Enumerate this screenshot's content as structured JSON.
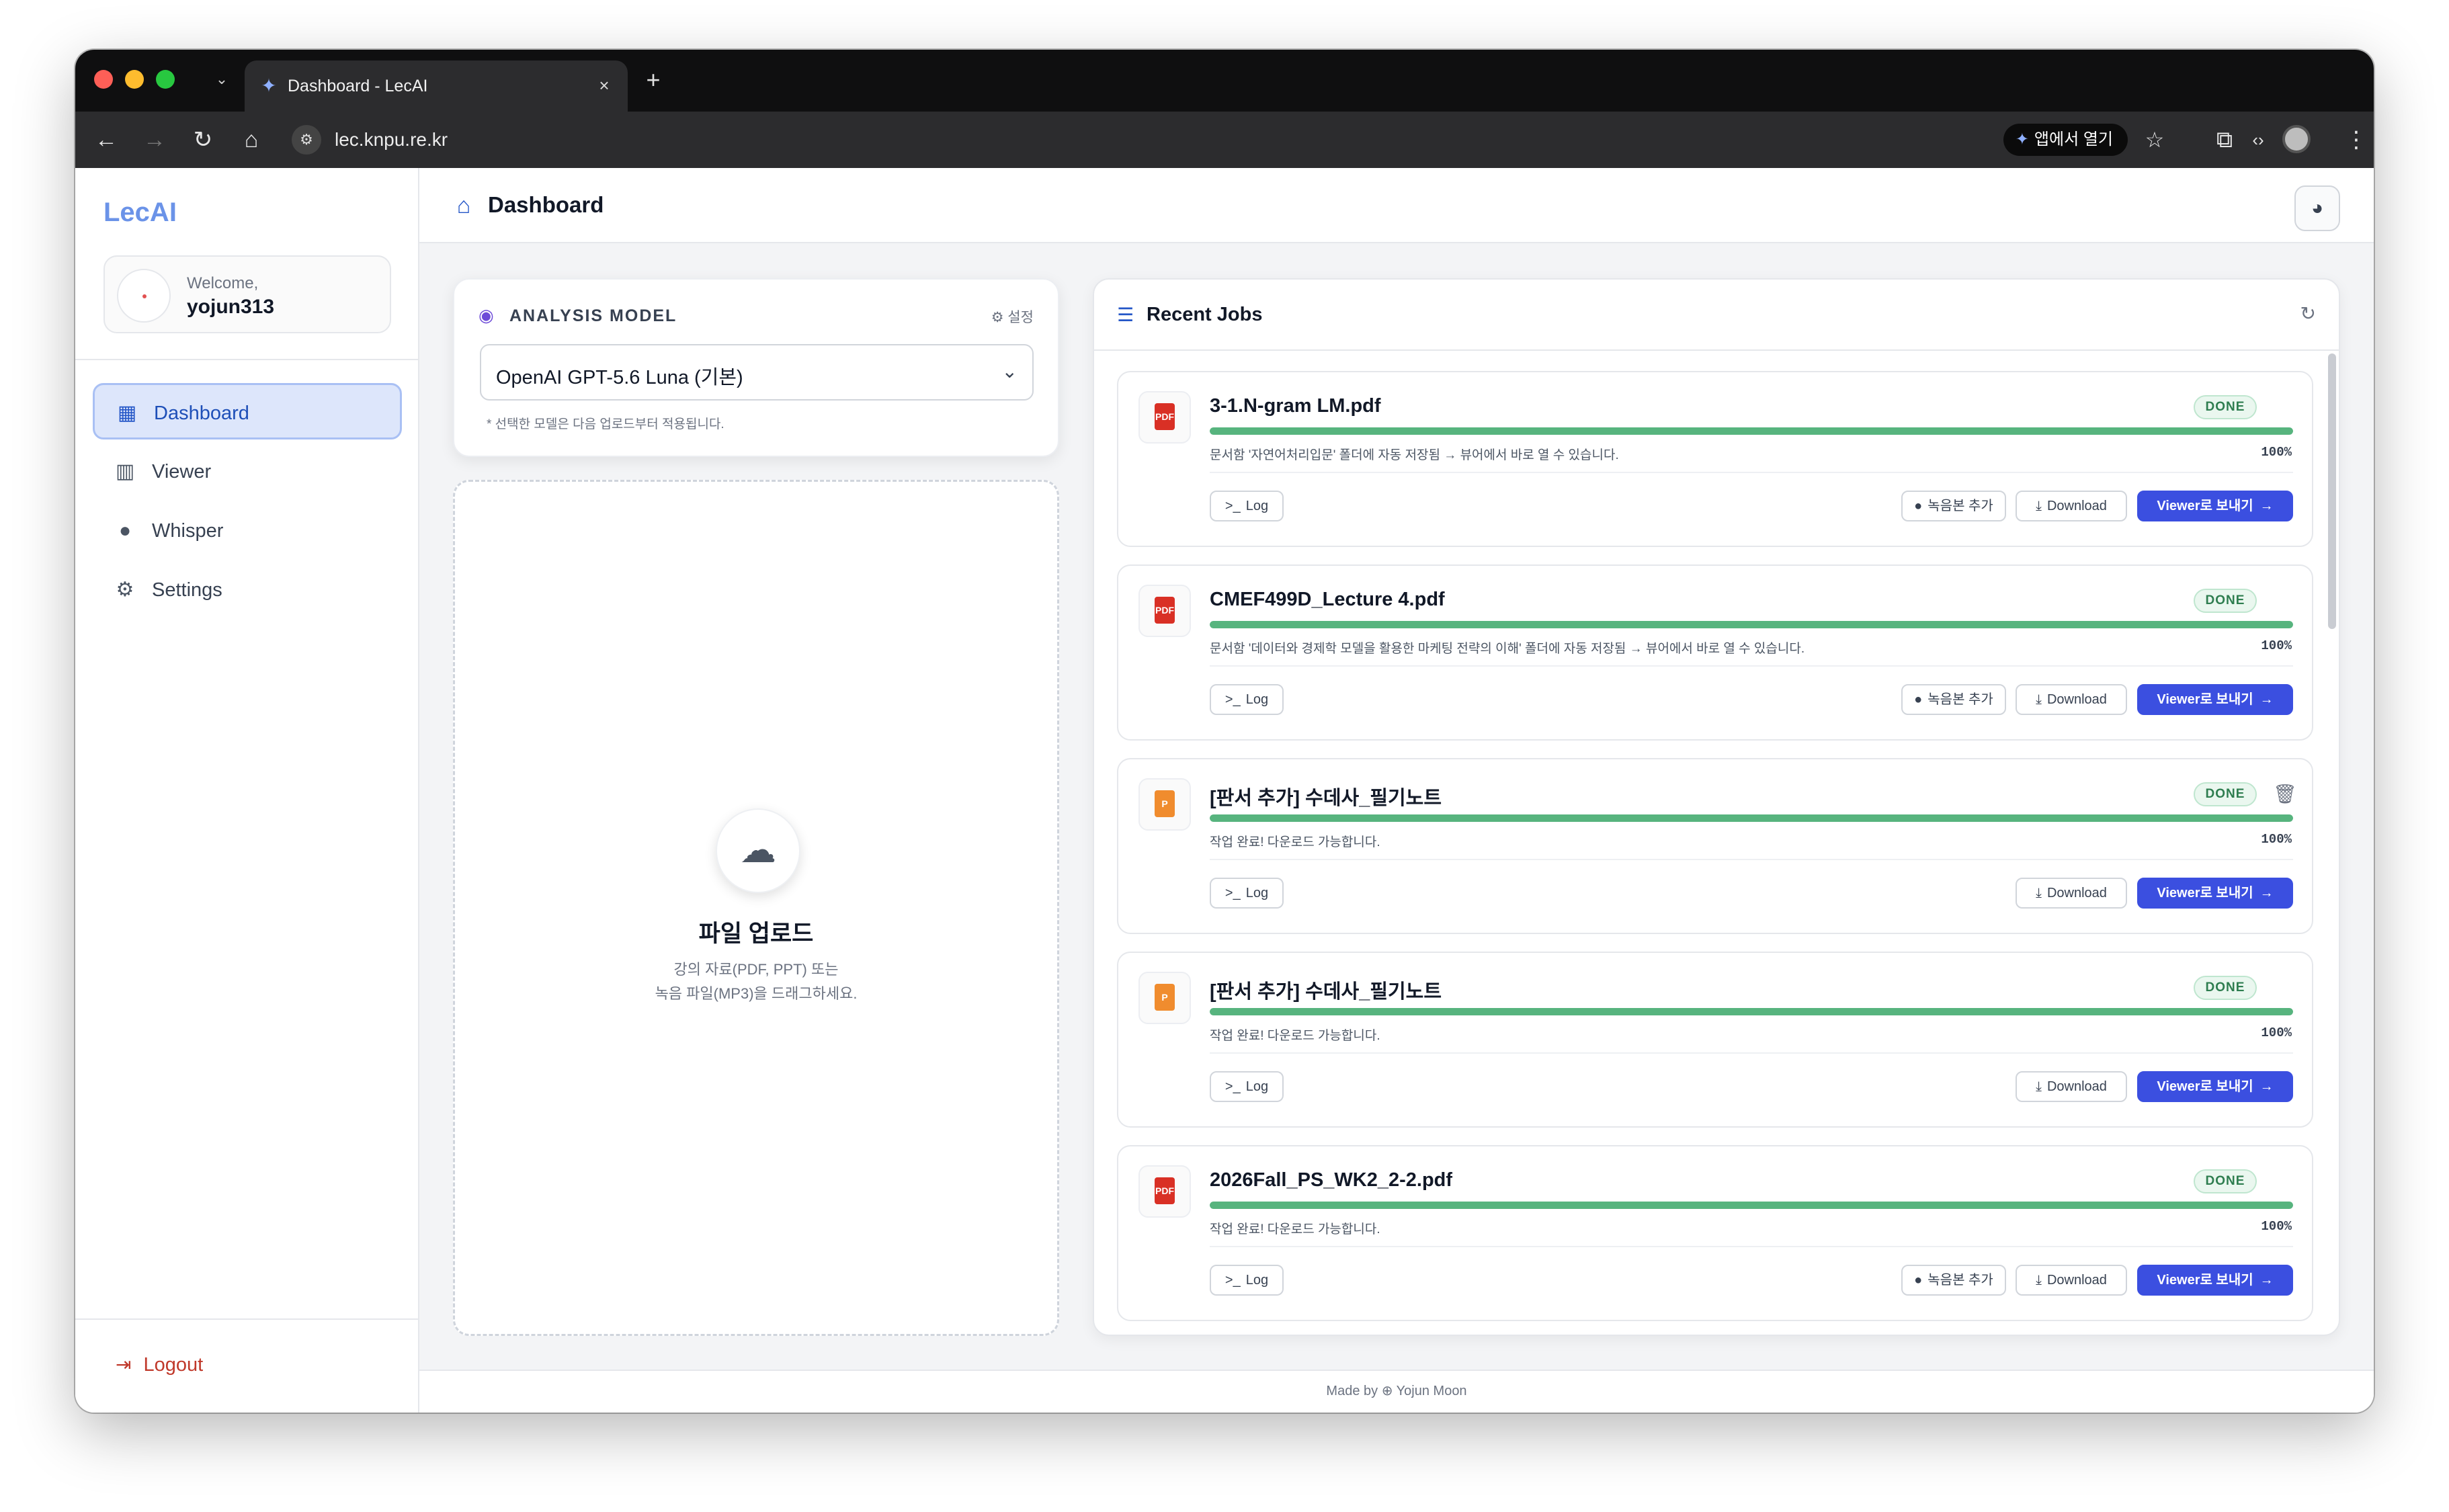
{
  "browser": {
    "tab_title": "Dashboard - LecAI",
    "url": "lec.knpu.re.kr",
    "open_in_app": "앱에서 열기"
  },
  "sidebar": {
    "brand": "LecAI",
    "welcome": "Welcome,",
    "username": "yojun313",
    "items": [
      {
        "label": "Dashboard",
        "icon": "dashboard-icon",
        "active": true
      },
      {
        "label": "Viewer",
        "icon": "book-icon",
        "active": false
      },
      {
        "label": "Whisper",
        "icon": "microphone-icon",
        "active": false
      },
      {
        "label": "Settings",
        "icon": "gear-icon",
        "active": false
      }
    ],
    "logout": "Logout"
  },
  "header": {
    "title": "Dashboard"
  },
  "model": {
    "heading": "ANALYSIS MODEL",
    "settings_link": "설정",
    "selected": "OpenAI GPT-5.6 Luna (기본)",
    "note": "* 선택한 모델은 다음 업로드부터 적용됩니다."
  },
  "upload": {
    "title": "파일 업로드",
    "desc_line1": "강의 자료(PDF, PPT) 또는",
    "desc_line2": "녹음 파일(MP3)을 드래그하세요."
  },
  "jobs": {
    "title": "Recent Jobs",
    "log_label": "Log",
    "record_label": "녹음본 추가",
    "download_label": "Download",
    "viewer_label": "Viewer로 보내기",
    "items": [
      {
        "name": "3-1.N-gram LM.pdf",
        "type": "pdf",
        "status": "DONE",
        "progress": 100,
        "pct": "100%",
        "message": "문서함 '자연어처리입문' 폴더에 자동 저장됨 → 뷰어에서 바로 열 수 있습니다.",
        "has_record": true,
        "has_trash": false
      },
      {
        "name": "CMEF499D_Lecture 4.pdf",
        "type": "pdf",
        "status": "DONE",
        "progress": 100,
        "pct": "100%",
        "message": "문서함 '데이터와 경제학 모델을 활용한 마케팅 전략의 이해' 폴더에 자동 저장됨 → 뷰어에서 바로 열 수 있습니다.",
        "has_record": true,
        "has_trash": false
      },
      {
        "name": "[판서 추가] 수데사_필기노트",
        "type": "ppt",
        "status": "DONE",
        "progress": 100,
        "pct": "100%",
        "message": "작업 완료! 다운로드 가능합니다.",
        "has_record": false,
        "has_trash": true
      },
      {
        "name": "[판서 추가] 수데사_필기노트",
        "type": "ppt",
        "status": "DONE",
        "progress": 100,
        "pct": "100%",
        "message": "작업 완료! 다운로드 가능합니다.",
        "has_record": false,
        "has_trash": false
      },
      {
        "name": "2026Fall_PS_WK2_2-2.pdf",
        "type": "pdf",
        "status": "DONE",
        "progress": 100,
        "pct": "100%",
        "message": "작업 완료! 다운로드 가능합니다.",
        "has_record": true,
        "has_trash": false
      }
    ]
  },
  "footer": {
    "made_by": "Made by",
    "author": "Yojun Moon"
  },
  "colors": {
    "accent": "#3b4fe0",
    "brand": "#6b93e8",
    "progress": "#57b47e",
    "logout": "#c0392b"
  }
}
